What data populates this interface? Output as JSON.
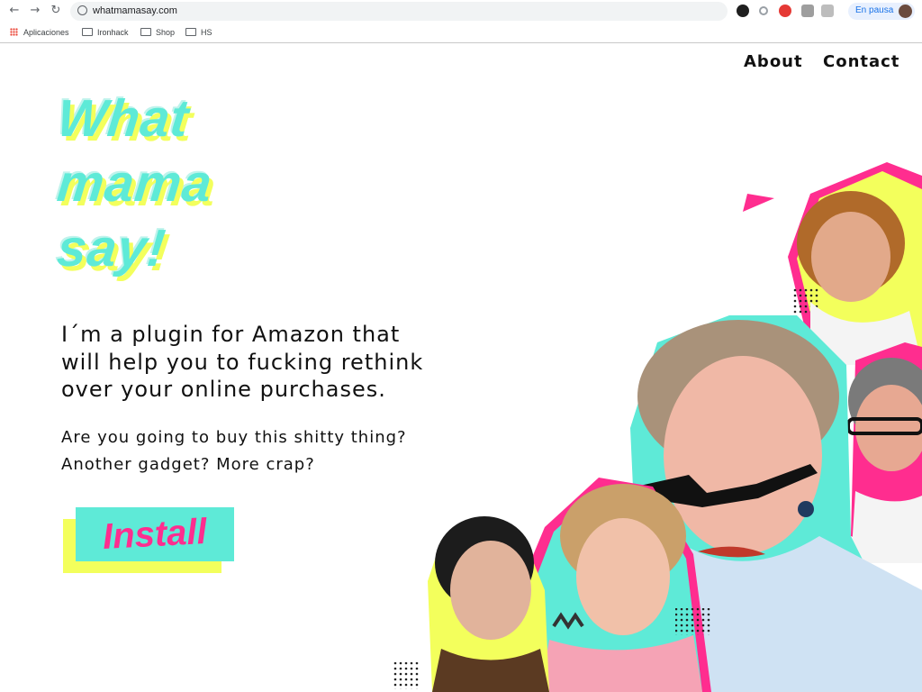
{
  "browser": {
    "url": "whatmamasay.com",
    "pause_label": "En pausa",
    "bookmarks": [
      "Aplicaciones",
      "Ironhack",
      "Shop",
      "HS"
    ],
    "icons": [
      "back-arrow-icon",
      "forward-arrow-icon",
      "reload-icon",
      "globe-icon"
    ]
  },
  "nav": {
    "about": "About",
    "contact": "Contact"
  },
  "hero": {
    "headline_lines": [
      "What",
      "mama",
      "say!"
    ],
    "lead_lines": [
      "I´m a plugin for Amazon that",
      "will help you to fucking rethink",
      "over your online purchases."
    ],
    "sub_lines": [
      "Are you going to buy this shitty thing?",
      "Another gadget? More crap?"
    ],
    "install_label": "Install"
  },
  "colors": {
    "turquoise": "#5eead7",
    "yellow": "#f3ff5c",
    "pink": "#ff2d8f"
  }
}
